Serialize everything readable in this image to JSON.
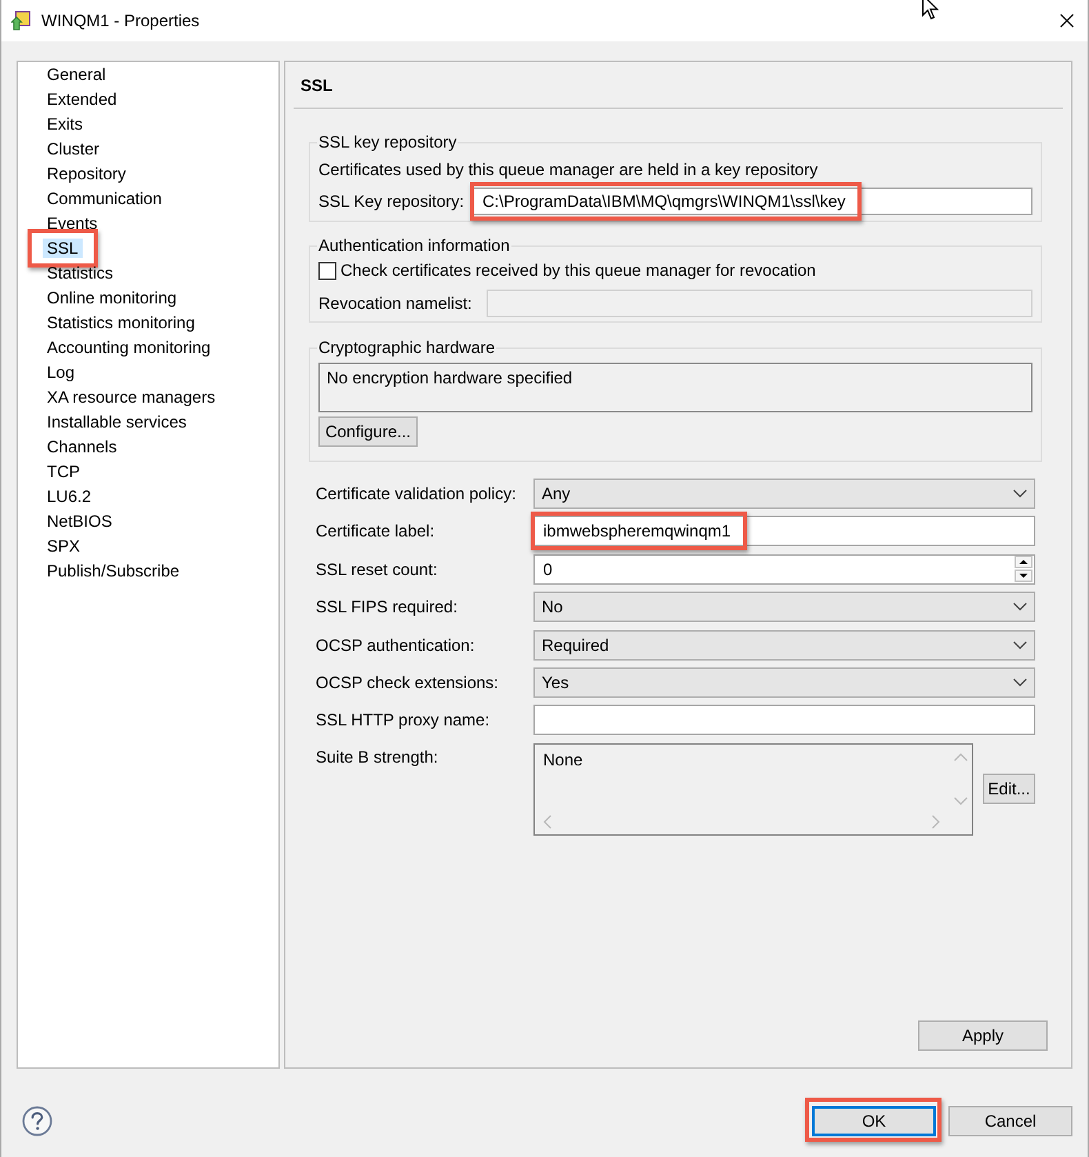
{
  "window": {
    "title": "WINQM1 - Properties"
  },
  "nav": [
    {
      "label": "General",
      "selected": false,
      "highlighted": false
    },
    {
      "label": "Extended",
      "selected": false,
      "highlighted": false
    },
    {
      "label": "Exits",
      "selected": false,
      "highlighted": false
    },
    {
      "label": "Cluster",
      "selected": false,
      "highlighted": false
    },
    {
      "label": "Repository",
      "selected": false,
      "highlighted": false
    },
    {
      "label": "Communication",
      "selected": false,
      "highlighted": false
    },
    {
      "label": "Events",
      "selected": false,
      "highlighted": false
    },
    {
      "label": "SSL",
      "selected": true,
      "highlighted": true
    },
    {
      "label": "Statistics",
      "selected": false,
      "highlighted": false
    },
    {
      "label": "Online monitoring",
      "selected": false,
      "highlighted": false
    },
    {
      "label": "Statistics monitoring",
      "selected": false,
      "highlighted": false
    },
    {
      "label": "Accounting monitoring",
      "selected": false,
      "highlighted": false
    },
    {
      "label": "Log",
      "selected": false,
      "highlighted": false
    },
    {
      "label": "XA resource managers",
      "selected": false,
      "highlighted": false
    },
    {
      "label": "Installable services",
      "selected": false,
      "highlighted": false
    },
    {
      "label": "Channels",
      "selected": false,
      "highlighted": false
    },
    {
      "label": "TCP",
      "selected": false,
      "highlighted": false
    },
    {
      "label": "LU6.2",
      "selected": false,
      "highlighted": false
    },
    {
      "label": "NetBIOS",
      "selected": false,
      "highlighted": false
    },
    {
      "label": "SPX",
      "selected": false,
      "highlighted": false
    },
    {
      "label": "Publish/Subscribe",
      "selected": false,
      "highlighted": false
    }
  ],
  "page": {
    "title": "SSL"
  },
  "key_repository": {
    "title": "SSL key repository",
    "description": "Certificates used by this queue manager are held in a key repository",
    "label": "SSL Key repository:",
    "value": "C:\\ProgramData\\IBM\\MQ\\qmgrs\\WINQM1\\ssl\\key",
    "highlighted": true
  },
  "authentication": {
    "title": "Authentication information",
    "check": {
      "label": "Check certificates received by this queue manager for revocation",
      "checked": false
    },
    "namelist": {
      "label": "Revocation namelist:",
      "disabled": true
    }
  },
  "crypto_hardware": {
    "title": "Cryptographic hardware",
    "text": "No encryption hardware specified",
    "button": "Configure..."
  },
  "fields": [
    {
      "kind": "combo",
      "label": "Certificate validation policy:",
      "value": "Any",
      "highlighted": false
    },
    {
      "kind": "text",
      "label": "Certificate label:",
      "value": "ibmwebspheremqwinqm1",
      "highlighted": true
    },
    {
      "kind": "spinner",
      "label": "SSL reset count:",
      "value": "0",
      "highlighted": false
    },
    {
      "kind": "combo",
      "label": "SSL FIPS required:",
      "value": "No",
      "highlighted": false
    },
    {
      "kind": "combo",
      "label": "OCSP authentication:",
      "value": "Required",
      "highlighted": false
    },
    {
      "kind": "combo",
      "label": "OCSP check extensions:",
      "value": "Yes",
      "highlighted": false
    },
    {
      "kind": "text",
      "label": "SSL HTTP proxy name:",
      "highlighted": false
    },
    {
      "kind": "list",
      "label": "Suite B strength:",
      "items": [
        "None"
      ],
      "button": "Edit...",
      "highlighted": false
    }
  ],
  "apply_button": "Apply",
  "buttons": [
    {
      "label": "OK",
      "default": true,
      "highlighted": true
    },
    {
      "label": "Cancel",
      "default": false,
      "highlighted": false
    }
  ]
}
